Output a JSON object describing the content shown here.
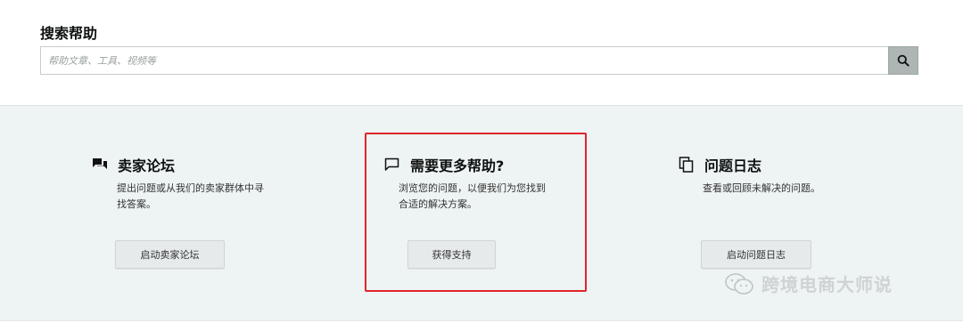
{
  "search": {
    "title": "搜索帮助",
    "placeholder": "帮助文章、工具、视频等",
    "button_icon": "search-icon"
  },
  "cards": [
    {
      "icon": "forum-chat-icon",
      "title": "卖家论坛",
      "desc": [
        "提出问题或从我们的卖家群体中寻",
        "找答案。"
      ],
      "button": "启动卖家论坛"
    },
    {
      "icon": "speech-bubble-icon",
      "title": "需要更多帮助?",
      "desc": [
        "浏览您的问题，以便我们为您找到",
        "合适的解决方案。"
      ],
      "button": "获得支持"
    },
    {
      "icon": "copy-log-icon",
      "title": "问题日志",
      "desc": [
        "查看或回顾未解决的问题。"
      ],
      "button": "启动问题日志"
    }
  ],
  "watermark": {
    "text": "跨境电商大师说",
    "icon": "wechat-icon"
  },
  "colors": {
    "highlight": "#e0242a",
    "panel_bg": "#eef3f3",
    "search_button_bg": "#aeb5b5"
  }
}
